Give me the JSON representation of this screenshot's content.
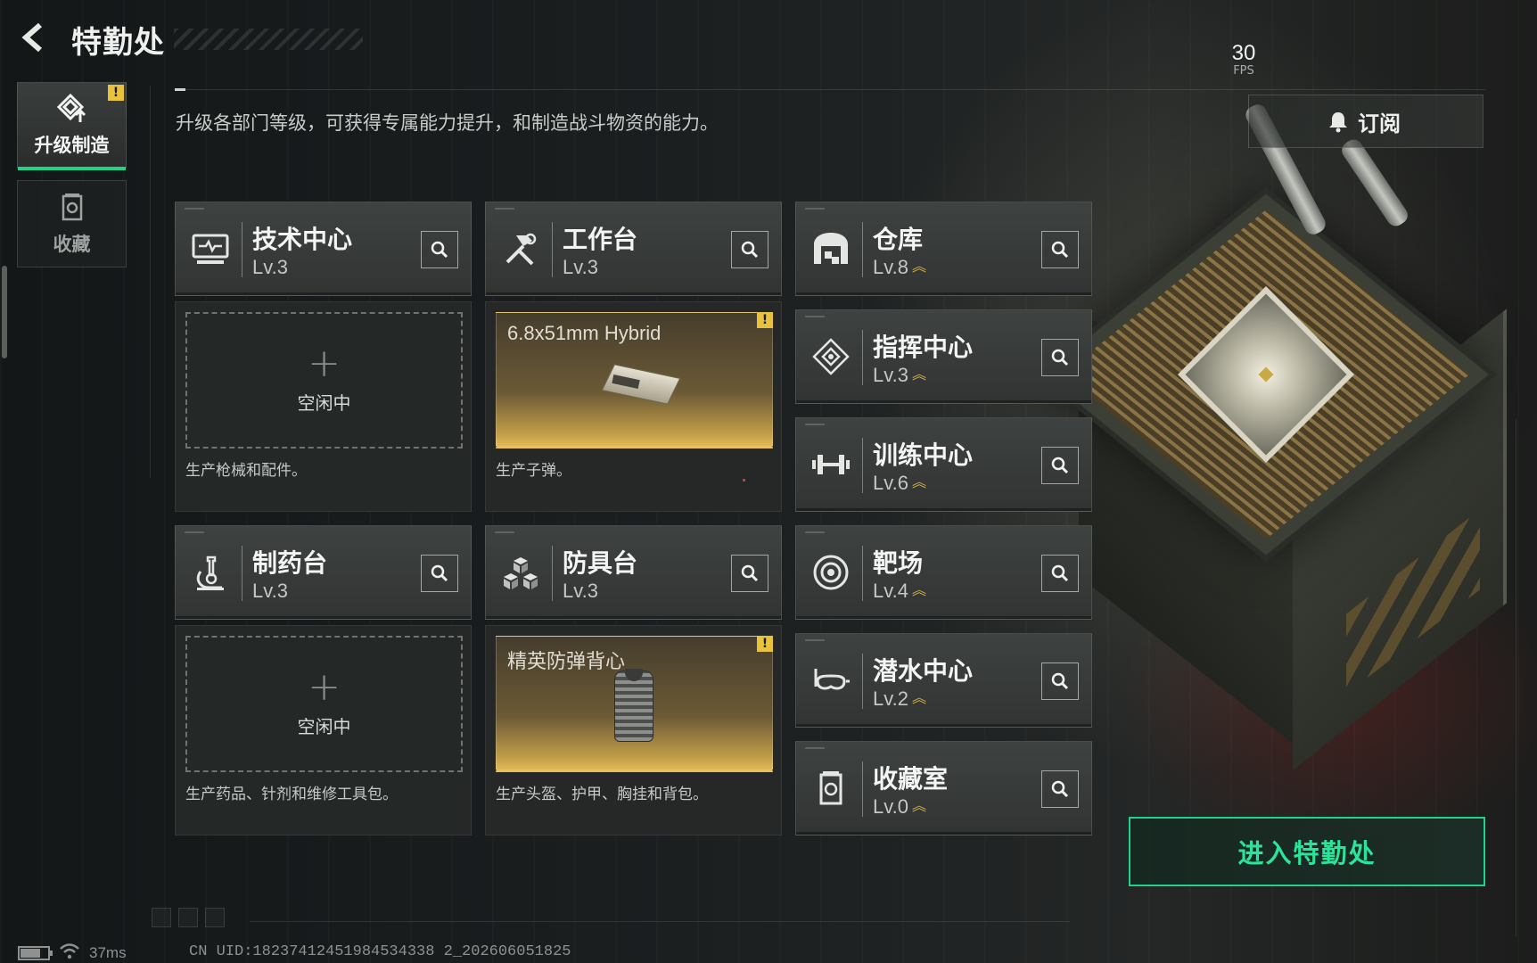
{
  "header": {
    "title": "特勤处",
    "subtitle": "升级各部门等级，可获得专属能力提升，和制造战斗物资的能力。",
    "subscribe_label": "订阅"
  },
  "fps": {
    "value": "30",
    "unit": "FPS"
  },
  "sidebar": {
    "items": [
      {
        "label": "升级制造",
        "active": true,
        "alert": "!"
      },
      {
        "label": "收藏",
        "active": false
      }
    ]
  },
  "departments": [
    {
      "name": "技术中心",
      "level": "Lv.3",
      "icon": "monitor-icon",
      "upgradable": false
    },
    {
      "name": "工作台",
      "level": "Lv.3",
      "icon": "hammer-wrench-icon",
      "upgradable": false
    },
    {
      "name": "仓库",
      "level": "Lv.8",
      "icon": "warehouse-icon",
      "upgradable": true
    },
    {
      "name": "指挥中心",
      "level": "Lv.3",
      "icon": "command-diamond-icon",
      "upgradable": true
    },
    {
      "name": "训练中心",
      "level": "Lv.6",
      "icon": "dumbbell-icon",
      "upgradable": true
    },
    {
      "name": "制药台",
      "level": "Lv.3",
      "icon": "microscope-icon",
      "upgradable": false
    },
    {
      "name": "防具台",
      "level": "Lv.3",
      "icon": "cubes-icon",
      "upgradable": false
    },
    {
      "name": "靶场",
      "level": "Lv.4",
      "icon": "target-icon",
      "upgradable": true
    },
    {
      "name": "潜水中心",
      "level": "Lv.2",
      "icon": "diving-mask-icon",
      "upgradable": true
    },
    {
      "name": "收藏室",
      "level": "Lv.0",
      "icon": "collection-icon",
      "upgradable": true
    }
  ],
  "production": {
    "tech_center": {
      "status": "空闲中",
      "desc": "生产枪械和配件。"
    },
    "workbench": {
      "item": "6.8x51mm Hybrid",
      "desc": "生产子弹。",
      "alert": "!"
    },
    "pharmacy": {
      "status": "空闲中",
      "desc": "生产药品、针剂和维修工具包。"
    },
    "armor_bench": {
      "item": "精英防弹背心",
      "desc": "生产头盔、护甲、胸挂和背包。",
      "alert": "!"
    }
  },
  "enter_button": {
    "label": "进入特勤处"
  },
  "status_bar": {
    "ping": "37ms",
    "uid": "CN UID:18237412451984534338 2_202606051825"
  },
  "colors": {
    "accent_green": "#1fd48a",
    "alert_yellow": "#e8c23c",
    "upgrade_gold": "#d9b24a"
  }
}
